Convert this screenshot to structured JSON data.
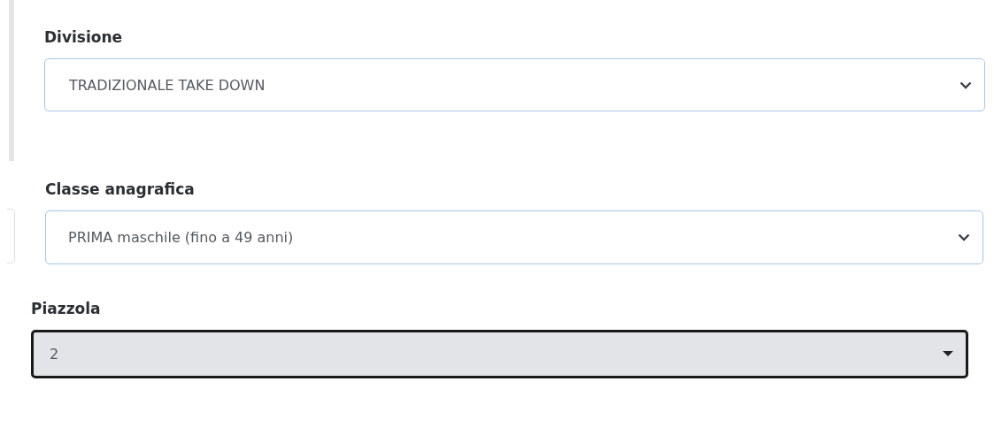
{
  "fields": [
    {
      "kind": "chevron",
      "label": "Divisione",
      "value": "TRADIZIONALE TAKE DOWN",
      "disabled": false
    },
    {
      "kind": "chevron",
      "label": "Classe anagrafica",
      "value": "PRIMA maschile (fino a 49 anni)",
      "disabled": false
    },
    {
      "kind": "caret",
      "label": "Piazzola",
      "value": "2",
      "disabled": true
    }
  ]
}
